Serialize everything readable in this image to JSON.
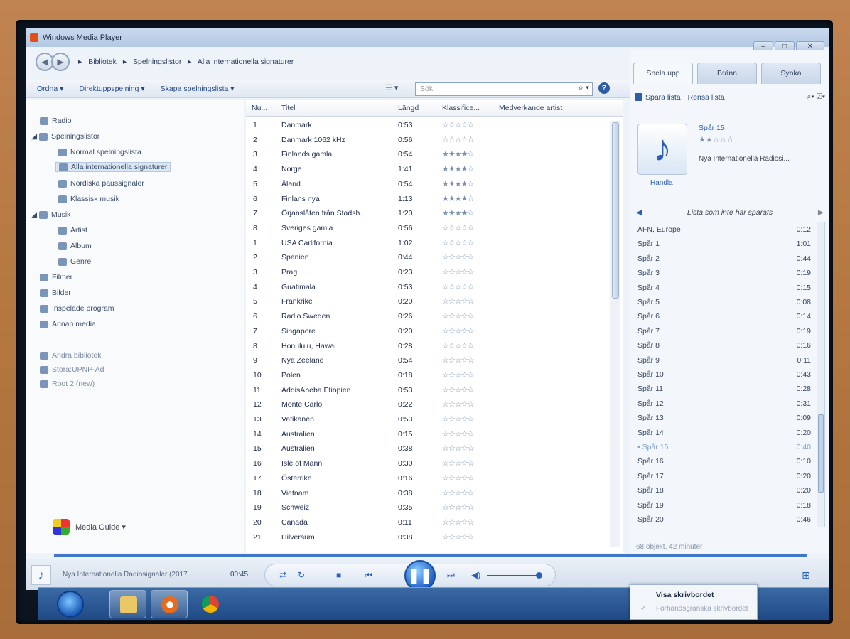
{
  "window": {
    "title": "Windows Media Player"
  },
  "breadcrumb": [
    "Bibliotek",
    "Spelningslistor",
    "Alla internationella signaturer"
  ],
  "toolbar": {
    "ordna": "Ordna ▾",
    "direktuppspelning": "Direktuppspelning ▾",
    "skapa": "Skapa spelningslista ▾",
    "search_placeholder": "Sök"
  },
  "nav": {
    "radio": "Radio",
    "spelningslistor": "Spelningslistor",
    "normal": "Normal spelningslista",
    "alla": "Alla internationella signaturer",
    "nordiska": "Nordiska paussignaler",
    "klassisk": "Klassisk musik",
    "musik": "Musik",
    "artist": "Artist",
    "album": "Album",
    "genre": "Genre",
    "filmer": "Filmer",
    "bilder": "Bilder",
    "inspelade": "Inspelade program",
    "annan": "Annan media",
    "andra": "Andra bibliotek",
    "stora": "Stora:UPNP-Ad",
    "root": "Root 2 (new)",
    "media_guide": "Media Guide ▾"
  },
  "columns": {
    "nu": "Nu...",
    "titel": "Titel",
    "langd": "Längd",
    "klass": "Klassifice...",
    "medv": "Medverkande artist"
  },
  "tracks": [
    {
      "nr": "1",
      "title": "Danmark",
      "len": "0:53",
      "stars": "☆☆☆☆☆"
    },
    {
      "nr": "2",
      "title": "Danmark 1062 kHz",
      "len": "0:56",
      "stars": "☆☆☆☆☆"
    },
    {
      "nr": "3",
      "title": "Finlands gamla",
      "len": "0:54",
      "stars": "★★★★☆"
    },
    {
      "nr": "4",
      "title": "Norge",
      "len": "1:41",
      "stars": "★★★★☆"
    },
    {
      "nr": "5",
      "title": "Åland",
      "len": "0:54",
      "stars": "★★★★☆"
    },
    {
      "nr": "6",
      "title": "Finlans nya",
      "len": "1:13",
      "stars": "★★★★☆"
    },
    {
      "nr": "7",
      "title": "Örjanslåten från Stadsh...",
      "len": "1:20",
      "stars": "★★★★☆"
    },
    {
      "nr": "8",
      "title": "Sveriges gamla",
      "len": "0:56",
      "stars": "☆☆☆☆☆"
    },
    {
      "nr": "1",
      "title": "USA Carlifornia",
      "len": "1:02",
      "stars": "☆☆☆☆☆"
    },
    {
      "nr": "2",
      "title": "Spanien",
      "len": "0:44",
      "stars": "☆☆☆☆☆"
    },
    {
      "nr": "3",
      "title": "Prag",
      "len": "0:23",
      "stars": "☆☆☆☆☆"
    },
    {
      "nr": "4",
      "title": "Guatimala",
      "len": "0:53",
      "stars": "☆☆☆☆☆"
    },
    {
      "nr": "5",
      "title": "Frankrike",
      "len": "0:20",
      "stars": "☆☆☆☆☆"
    },
    {
      "nr": "6",
      "title": "Radio Sweden",
      "len": "0:26",
      "stars": "☆☆☆☆☆"
    },
    {
      "nr": "7",
      "title": "Singapore",
      "len": "0:20",
      "stars": "☆☆☆☆☆"
    },
    {
      "nr": "8",
      "title": "Honululu, Hawai",
      "len": "0:28",
      "stars": "☆☆☆☆☆"
    },
    {
      "nr": "9",
      "title": "Nya Zeeland",
      "len": "0:54",
      "stars": "☆☆☆☆☆"
    },
    {
      "nr": "10",
      "title": "Polen",
      "len": "0:18",
      "stars": "☆☆☆☆☆"
    },
    {
      "nr": "11",
      "title": "AddisAbeba Etiopien",
      "len": "0:53",
      "stars": "☆☆☆☆☆"
    },
    {
      "nr": "12",
      "title": "Monte Carlo",
      "len": "0:22",
      "stars": "☆☆☆☆☆"
    },
    {
      "nr": "13",
      "title": "Vatikanen",
      "len": "0:53",
      "stars": "☆☆☆☆☆"
    },
    {
      "nr": "14",
      "title": "Australien",
      "len": "0:15",
      "stars": "☆☆☆☆☆"
    },
    {
      "nr": "15",
      "title": "Australien",
      "len": "0:38",
      "stars": "☆☆☆☆☆"
    },
    {
      "nr": "16",
      "title": "Isle of Mann",
      "len": "0:30",
      "stars": "☆☆☆☆☆"
    },
    {
      "nr": "17",
      "title": "Österrike",
      "len": "0:16",
      "stars": "☆☆☆☆☆"
    },
    {
      "nr": "18",
      "title": "Vietnam",
      "len": "0:38",
      "stars": "☆☆☆☆☆"
    },
    {
      "nr": "19",
      "title": "Schweiz",
      "len": "0:35",
      "stars": "☆☆☆☆☆"
    },
    {
      "nr": "20",
      "title": "Canada",
      "len": "0:11",
      "stars": "☆☆☆☆☆"
    },
    {
      "nr": "21",
      "title": "Hilversum",
      "len": "0:38",
      "stars": "☆☆☆☆☆"
    }
  ],
  "tabs": {
    "spela": "Spela upp",
    "branna": "Bränn",
    "synka": "Synka"
  },
  "right_toolbar": {
    "spara": "Spara lista",
    "rensa": "Rensa lista"
  },
  "now_playing": {
    "track": "Spår 15",
    "stars": "★★☆☆☆",
    "album": "Nya Internationella Radiosi...",
    "handla": "Handla"
  },
  "playlist_header": "Lista som inte har sparats",
  "playlist": [
    {
      "name": "AFN, Europe",
      "dur": "0:12"
    },
    {
      "name": "Spår 1",
      "dur": "1:01"
    },
    {
      "name": "Spår 2",
      "dur": "0:44"
    },
    {
      "name": "Spår 3",
      "dur": "0:19"
    },
    {
      "name": "Spår 4",
      "dur": "0:15"
    },
    {
      "name": "Spår 5",
      "dur": "0:08"
    },
    {
      "name": "Spår 6",
      "dur": "0:14"
    },
    {
      "name": "Spår 7",
      "dur": "0:19"
    },
    {
      "name": "Spår 8",
      "dur": "0:16"
    },
    {
      "name": "Spår 9",
      "dur": "0:11"
    },
    {
      "name": "Spår 10",
      "dur": "0:43"
    },
    {
      "name": "Spår 11",
      "dur": "0:28"
    },
    {
      "name": "Spår 12",
      "dur": "0:31"
    },
    {
      "name": "Spår 13",
      "dur": "0:09"
    },
    {
      "name": "Spår 14",
      "dur": "0:20"
    },
    {
      "name": "• Spår 15",
      "dur": "0:40"
    },
    {
      "name": "Spår 16",
      "dur": "0:10"
    },
    {
      "name": "Spår 17",
      "dur": "0:20"
    },
    {
      "name": "Spår 18",
      "dur": "0:20"
    },
    {
      "name": "Spår 19",
      "dur": "0:18"
    },
    {
      "name": "Spår 20",
      "dur": "0:46"
    }
  ],
  "playlist_footer": "68 objekt, 42 minuter",
  "player": {
    "title": "Nya Internationella Radiosignaler (2017...",
    "time": "00:45"
  },
  "context_menu": {
    "item1": "Visa skrivbordet",
    "item2": "Förhandsgranska skrivbordet"
  }
}
